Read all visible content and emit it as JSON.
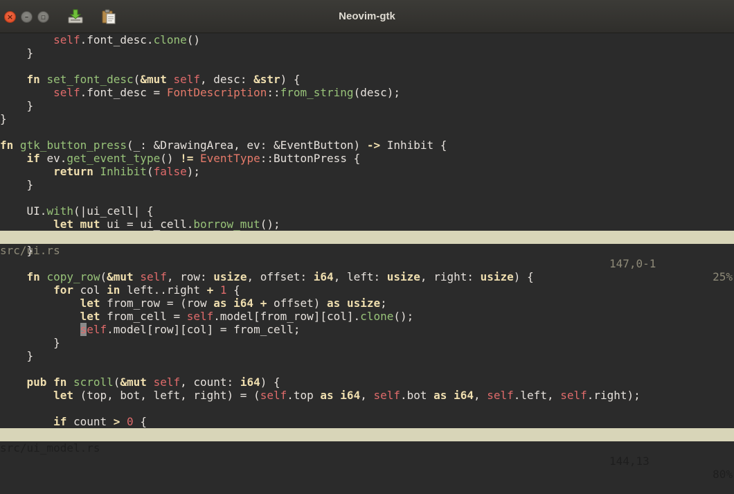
{
  "window": {
    "title": "Neovim-gtk",
    "controls": [
      "close",
      "minimize",
      "maximize"
    ],
    "toolbar_icons": [
      "save-icon",
      "paste-icon"
    ]
  },
  "top_pane": {
    "lines": [
      [
        [
          "",
          "        "
        ],
        [
          "slf",
          "self"
        ],
        [
          "",
          ".font_desc."
        ],
        [
          "fnc",
          "clone"
        ],
        [
          "",
          "()"
        ]
      ],
      [
        [
          "",
          "    }"
        ]
      ],
      [
        [
          "",
          ""
        ]
      ],
      [
        [
          "",
          "    "
        ],
        [
          "kw",
          "fn "
        ],
        [
          "fnc",
          "set_font_desc"
        ],
        [
          "",
          "("
        ],
        [
          "kw",
          "&mut "
        ],
        [
          "slf",
          "self"
        ],
        [
          "",
          ", desc: "
        ],
        [
          "kw",
          "&str"
        ],
        [
          "",
          ") {"
        ]
      ],
      [
        [
          "",
          "        "
        ],
        [
          "slf",
          "self"
        ],
        [
          "",
          ".font_desc = "
        ],
        [
          "cls",
          "FontDescription"
        ],
        [
          "",
          "::"
        ],
        [
          "fnc",
          "from_string"
        ],
        [
          "",
          "(desc);"
        ]
      ],
      [
        [
          "",
          "    }"
        ]
      ],
      [
        [
          "",
          "}"
        ]
      ],
      [
        [
          "",
          ""
        ]
      ],
      [
        [
          "kw",
          "fn "
        ],
        [
          "fnc",
          "gtk_button_press"
        ],
        [
          "",
          "(_: &DrawingArea, ev: &EventButton) "
        ],
        [
          "kw",
          "->"
        ],
        [
          "",
          " Inhibit {"
        ]
      ],
      [
        [
          "",
          "    "
        ],
        [
          "kw",
          "if "
        ],
        [
          "",
          "ev."
        ],
        [
          "fnc",
          "get_event_type"
        ],
        [
          "",
          "() "
        ],
        [
          "kw",
          "!="
        ],
        [
          "",
          " "
        ],
        [
          "cls",
          "EventType"
        ],
        [
          "",
          "::ButtonPress {"
        ]
      ],
      [
        [
          "",
          "        "
        ],
        [
          "kw",
          "return "
        ],
        [
          "fnc",
          "Inhibit"
        ],
        [
          "",
          "("
        ],
        [
          "num",
          "false"
        ],
        [
          "",
          ");"
        ]
      ],
      [
        [
          "",
          "    }"
        ]
      ],
      [
        [
          "",
          ""
        ]
      ],
      [
        [
          "",
          "    UI."
        ],
        [
          "fnc",
          "with"
        ],
        [
          "",
          "(|ui_cell| {"
        ]
      ],
      [
        [
          "",
          "        "
        ],
        [
          "kw",
          "let mut "
        ],
        [
          "",
          "ui = ui_cell."
        ],
        [
          "fnc",
          "borrow_mut"
        ],
        [
          "",
          "();"
        ]
      ]
    ],
    "status": {
      "file": "src/ui.rs",
      "position": "147,0-1",
      "percent": "25%"
    }
  },
  "bottom_pane": {
    "lines": [
      [
        [
          "",
          "    }"
        ]
      ],
      [
        [
          "",
          ""
        ]
      ],
      [
        [
          "",
          "    "
        ],
        [
          "kw",
          "fn "
        ],
        [
          "fnc",
          "copy_row"
        ],
        [
          "",
          "("
        ],
        [
          "kw",
          "&mut "
        ],
        [
          "slf",
          "self"
        ],
        [
          "",
          ", row: "
        ],
        [
          "typ",
          "usize"
        ],
        [
          "",
          ", offset: "
        ],
        [
          "typ",
          "i64"
        ],
        [
          "",
          ", left: "
        ],
        [
          "typ",
          "usize"
        ],
        [
          "",
          ", right: "
        ],
        [
          "typ",
          "usize"
        ],
        [
          "",
          ") {"
        ]
      ],
      [
        [
          "",
          "        "
        ],
        [
          "kw",
          "for "
        ],
        [
          "",
          "col "
        ],
        [
          "kw",
          "in "
        ],
        [
          "",
          "left..right "
        ],
        [
          "kw",
          "+"
        ],
        [
          "",
          " "
        ],
        [
          "num",
          "1"
        ],
        [
          "",
          " {"
        ]
      ],
      [
        [
          "",
          "            "
        ],
        [
          "kw",
          "let "
        ],
        [
          "",
          "from_row = (row "
        ],
        [
          "kw",
          "as "
        ],
        [
          "typ",
          "i64"
        ],
        [
          "",
          " "
        ],
        [
          "kw",
          "+"
        ],
        [
          "",
          " offset) "
        ],
        [
          "kw",
          "as "
        ],
        [
          "typ",
          "usize"
        ],
        [
          "",
          ";"
        ]
      ],
      [
        [
          "",
          "            "
        ],
        [
          "kw",
          "let "
        ],
        [
          "",
          "from_cell = "
        ],
        [
          "slf",
          "self"
        ],
        [
          "",
          ".model[from_row][col]."
        ],
        [
          "fnc",
          "clone"
        ],
        [
          "",
          "();"
        ]
      ],
      [
        [
          "",
          "            "
        ],
        [
          "cursor",
          "s"
        ],
        [
          "slf",
          "elf"
        ],
        [
          "",
          ".model[row][col] = from_cell;"
        ]
      ],
      [
        [
          "",
          "        }"
        ]
      ],
      [
        [
          "",
          "    }"
        ]
      ],
      [
        [
          "",
          ""
        ]
      ],
      [
        [
          "",
          "    "
        ],
        [
          "kw",
          "pub fn "
        ],
        [
          "fnc",
          "scroll"
        ],
        [
          "",
          "("
        ],
        [
          "kw",
          "&mut "
        ],
        [
          "slf",
          "self"
        ],
        [
          "",
          ", count: "
        ],
        [
          "typ",
          "i64"
        ],
        [
          "",
          ") {"
        ]
      ],
      [
        [
          "",
          "        "
        ],
        [
          "kw",
          "let "
        ],
        [
          "",
          "(top, bot, left, right) = ("
        ],
        [
          "slf",
          "self"
        ],
        [
          "",
          ".top "
        ],
        [
          "kw",
          "as "
        ],
        [
          "typ",
          "i64"
        ],
        [
          "",
          ", "
        ],
        [
          "slf",
          "self"
        ],
        [
          "",
          ".bot "
        ],
        [
          "kw",
          "as "
        ],
        [
          "typ",
          "i64"
        ],
        [
          "",
          ", "
        ],
        [
          "slf",
          "self"
        ],
        [
          "",
          ".left, "
        ],
        [
          "slf",
          "self"
        ],
        [
          "",
          ".right);"
        ]
      ],
      [
        [
          "",
          ""
        ]
      ],
      [
        [
          "",
          "        "
        ],
        [
          "kw",
          "if "
        ],
        [
          "",
          "count "
        ],
        [
          "kw",
          ">"
        ],
        [
          "",
          " "
        ],
        [
          "num",
          "0"
        ],
        [
          "",
          " {"
        ]
      ]
    ],
    "status": {
      "file": "src/ui_model.rs",
      "position": "144,13",
      "percent": "80%"
    }
  }
}
